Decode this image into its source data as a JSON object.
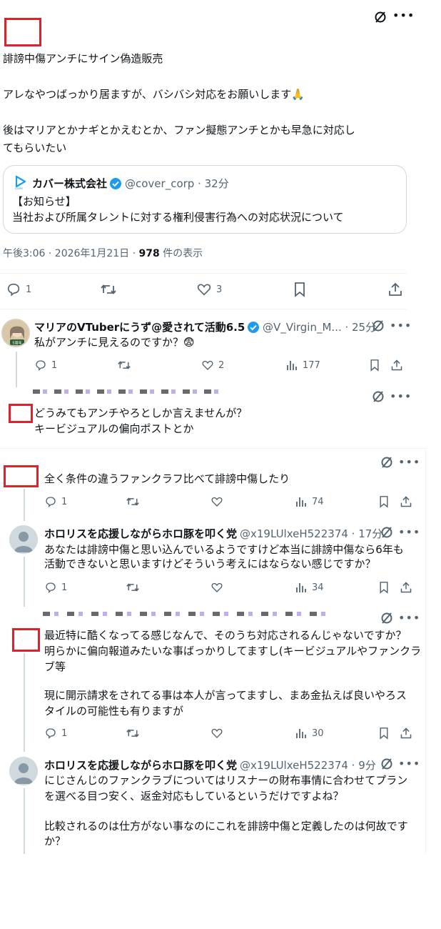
{
  "main_post": {
    "text_l1": "誹謗中傷アンチにサイン偽造販売",
    "text_l2": "アレなやつばっかり居ますが、バシバシ対応をお願いします🙏",
    "text_l3": "後はマリアとかナギとかえむとか、ファン擬態アンチとかも早急に対応し",
    "text_l4": "てもらいたい",
    "quote": {
      "name": "カバー株式会社",
      "handle": "@cover_corp · 32分",
      "line1": "【お知らせ】",
      "line2": "当社および所属タレントに対する権利侵害行為への対応状況について"
    },
    "meta_time": "午後3:06 · 2026年1月21日 · ",
    "meta_views": "978",
    "meta_views_suffix": " 件の表示",
    "replies": "1",
    "likes": "3"
  },
  "reply1": {
    "name": "マリアのVTuberにうず@愛されて活動6.5...",
    "handle": "@V_Virgin_M... · 25分",
    "text": "私がアンチに見えるのですか？😨",
    "replies": "1",
    "likes": "2",
    "views": "177",
    "avatar_badge": "5周年"
  },
  "reply2": {
    "line1": "どうみてもアンチやろとしか言えませんが？",
    "line2": "キービジュアルの偏向ポストとか"
  },
  "reply3": {
    "text": "全く条件の違うファンクラフ比べて誹謗中傷したり",
    "replies": "1",
    "views": "74"
  },
  "reply4": {
    "name": "ホロリスを応援しながらホロ豚を叩く党",
    "handle": "@x19LUlxeH522374 · 17分",
    "line1": "あなたは誹謗中傷と思い込んでいるようですけど本当に誹謗中傷なら6年も",
    "line2": "活動できないと思いますけどそういう考えにはならない感じですか？",
    "replies": "1",
    "views": "34"
  },
  "reply5": {
    "line1": "最近特に酷くなってる感じなんで、そのうち対応されるんじゃないですか？",
    "line2": "明らかに偏向報道みたいな事ばっかりしてますし(キービジュアルやファンクラ",
    "line3": "ブ等",
    "line4": "現に開示請求をされてる事は本人が言ってますし、まあ金払えば良いやろス",
    "line5": "タイルの可能性も有りますが",
    "replies": "1",
    "views": "30"
  },
  "reply6": {
    "name": "ホロリスを応援しながらホロ豚を叩く党",
    "handle": "@x19LUlxeH522374 · 9分",
    "line1": "にじさんじのファンクラブについてはリスナーの財布事情に合わせてプラン",
    "line2": "を選べる目つ安く、返金対応もしているというだけですよね？",
    "line3": "比較されるのは仕方がない事なのにこれを誹謗中傷と定義したのは何故です",
    "line4": "か？"
  },
  "colors": {
    "accent": "#1d9bf0",
    "muted": "#536471",
    "redact": "#e0202a"
  }
}
